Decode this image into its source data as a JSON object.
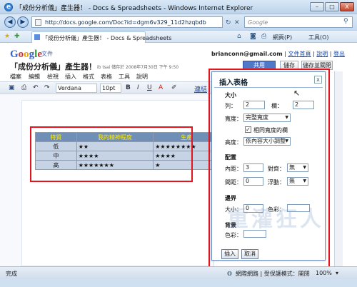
{
  "window": {
    "title": "「成份分析儀」產生器！ - Docs & Spreadsheets - Windows Internet Explorer",
    "min_label": "–",
    "max_label": "□",
    "close_label": "X"
  },
  "nav": {
    "address": "http://docs.google.com/Doc?id=dgm6v329_11d2hzqbdb",
    "search_placeholder": "Google"
  },
  "cmdbar": {
    "tab_title": "「成份分析儀」產生器！ - Docs & Spreadsheets",
    "page_label": "網頁(P)",
    "tools_label": "工具(O)"
  },
  "app": {
    "logo": "Google",
    "logo_suffix": "文件",
    "user_email": "brianconn@gmail.com",
    "links": [
      "文件首頁",
      "說明",
      "登出"
    ],
    "doc_title": "「成份分析儀」產生器！",
    "saved_text": "ib tsai 儲存於 2008年7月30日 下午 9:50",
    "share_label": "共用",
    "save_label": "儲存",
    "save_close_label": "儲存並關閉"
  },
  "menubar": [
    "檔案",
    "編輯",
    "檢視",
    "插入",
    "格式",
    "表格",
    "工具",
    "說明"
  ],
  "toolbar": {
    "font": "Verdana",
    "size": "10pt",
    "bold": "B",
    "italic": "I",
    "underline": "U",
    "link_label": "連結"
  },
  "doc_table": {
    "headers": [
      "特質",
      "我的精神程度",
      "生產"
    ],
    "rows": [
      [
        "低",
        "★★",
        "★★★★★★★★"
      ],
      [
        "中",
        "★★★★",
        "★★★★"
      ],
      [
        "高",
        "★★★★★★★",
        "★"
      ]
    ]
  },
  "dialog": {
    "title": "插入表格",
    "close": "x",
    "size_section": "大小",
    "rows_label": "列：",
    "rows_value": "2",
    "cols_label": "欄：",
    "cols_value": "2",
    "width_label": "寬度：",
    "width_value": "完整寬度",
    "equal_cols_label": "相同寬度的欄",
    "height_label": "高度：",
    "height_value": "依內容大小調整",
    "layout_section": "配置",
    "padding_label": "內距：",
    "padding_value": "3",
    "align_label": "對齊：",
    "align_value": "無",
    "spacing_label": "間距：",
    "spacing_value": "0",
    "float_label": "浮動：",
    "float_value": "無",
    "border_section": "邊界",
    "border_size_label": "大小：",
    "border_size_value": "0",
    "border_color_label": "色彩：",
    "bg_section": "背景",
    "bg_color_label": "色彩：",
    "insert_label": "插入",
    "cancel_label": "取消"
  },
  "status": {
    "left": "完成",
    "zone": "網際網路 | 受保護模式：開閉",
    "zoom": "100%"
  },
  "watermark": "重灌狂人"
}
